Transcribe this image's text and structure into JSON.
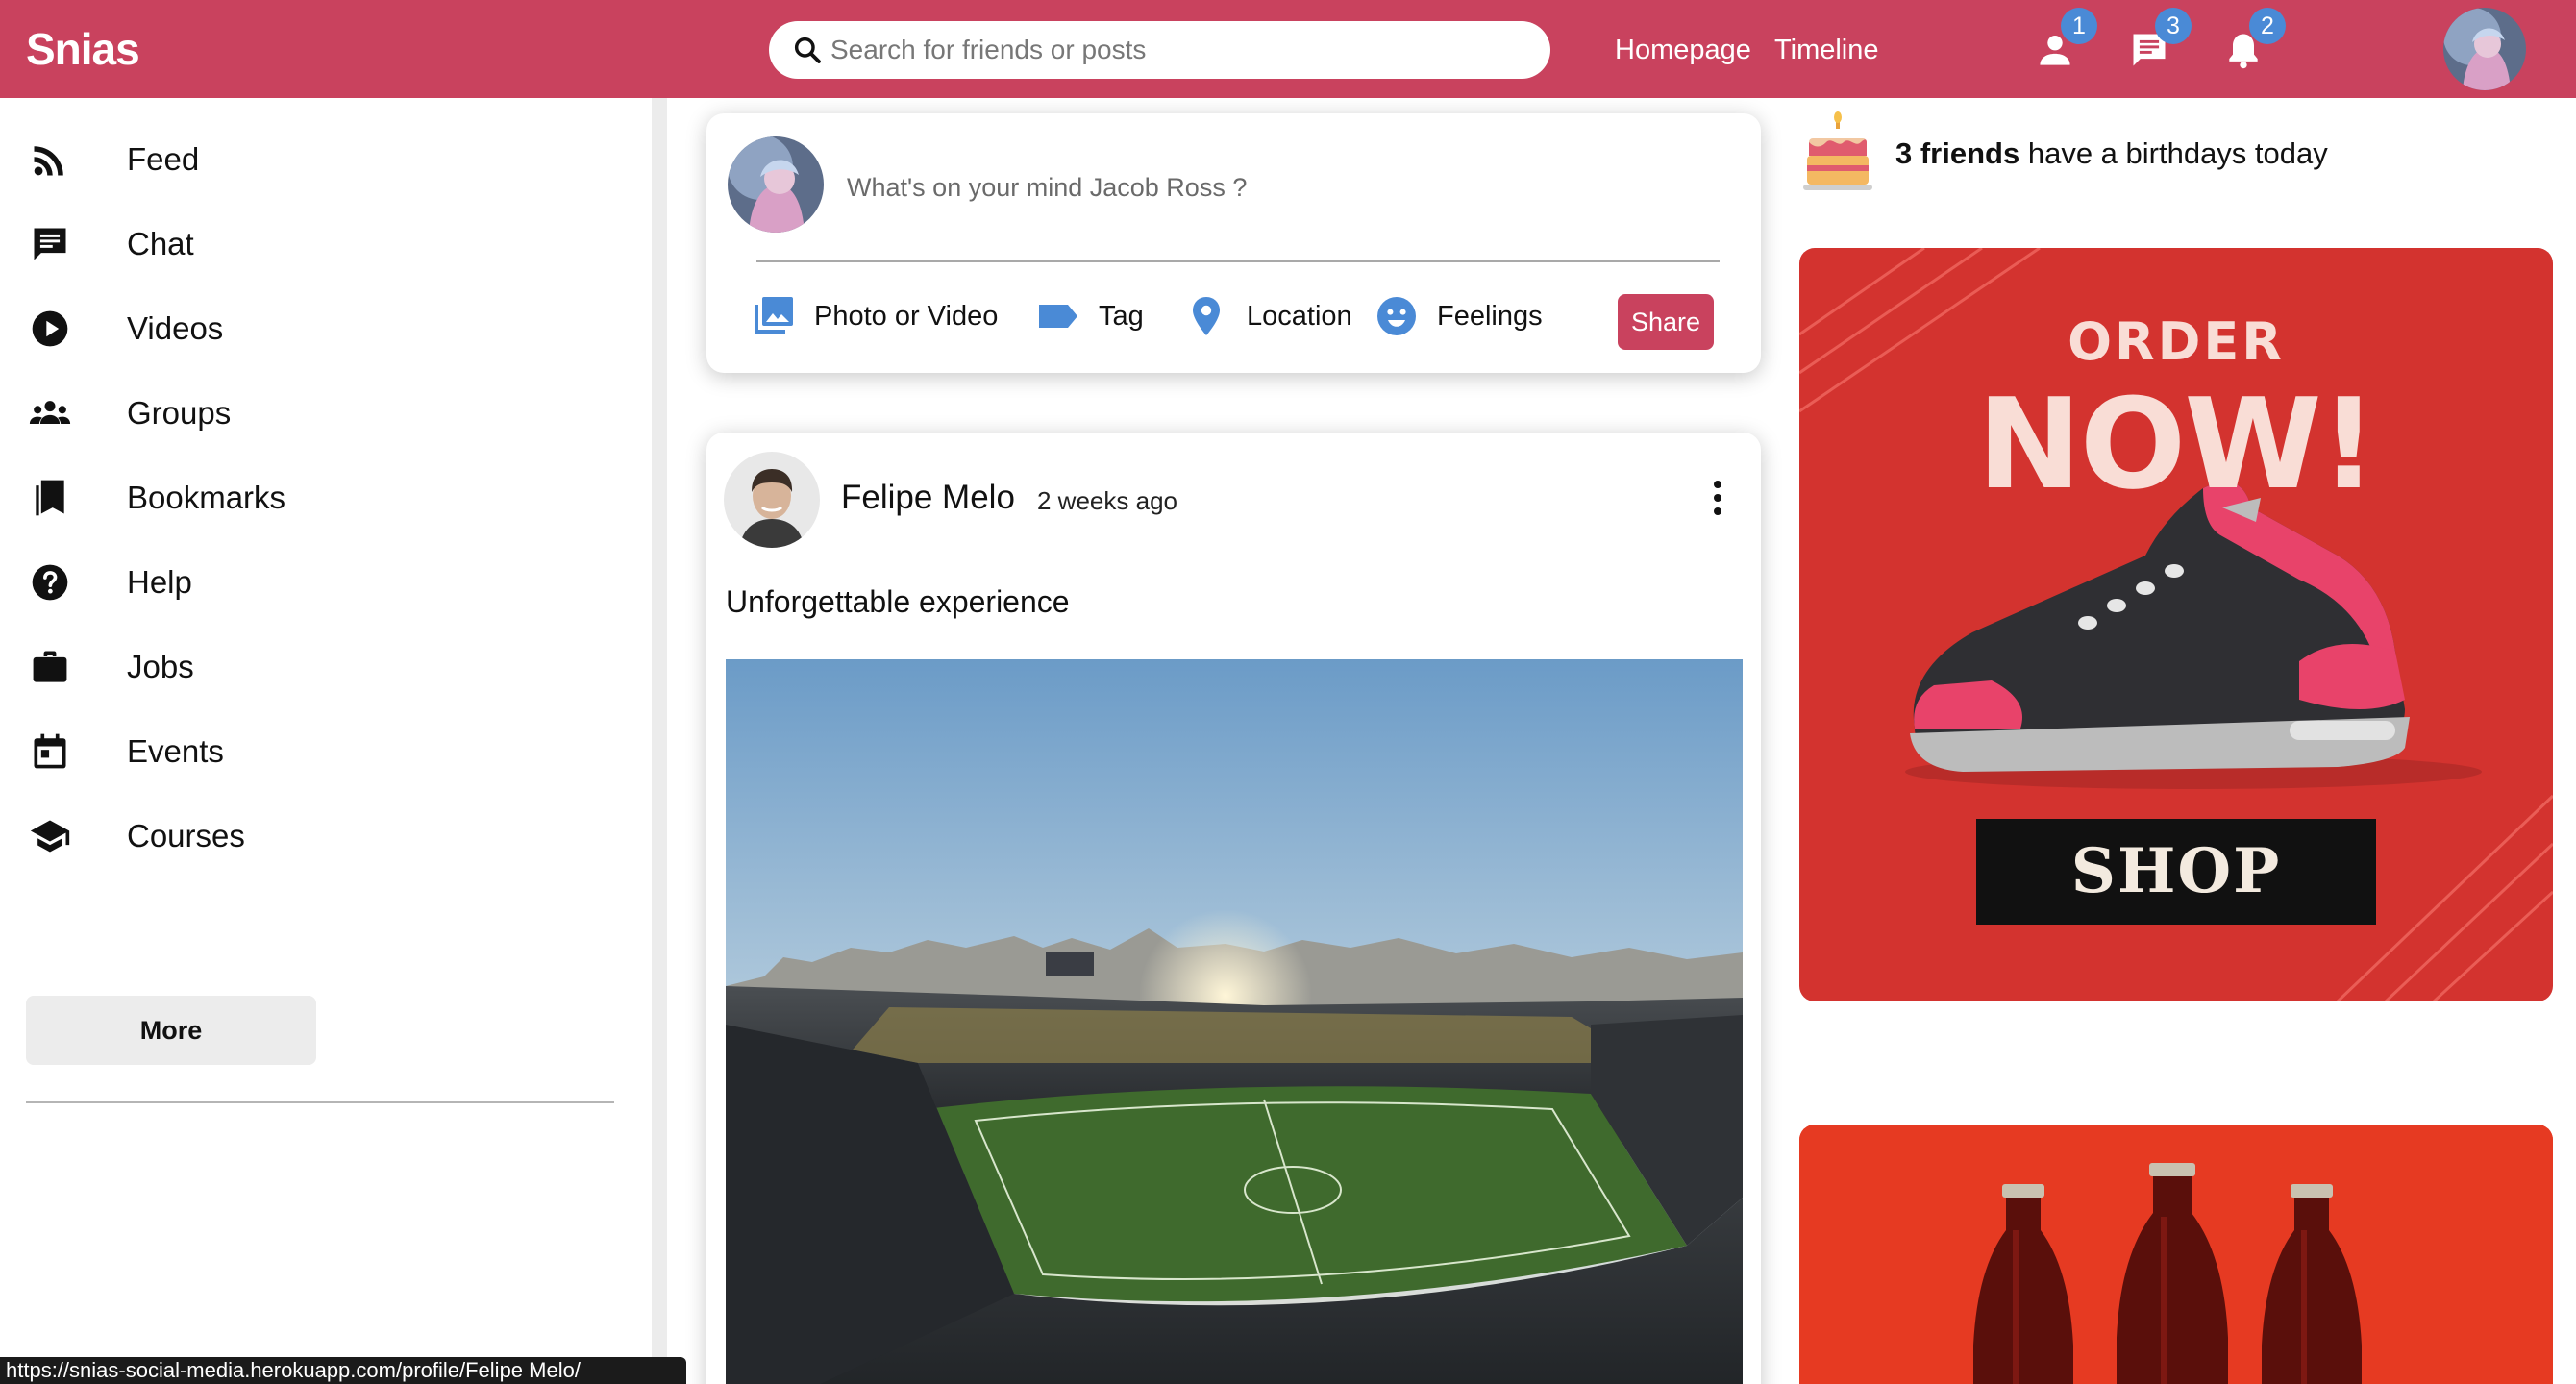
{
  "app": {
    "name": "Snias"
  },
  "search": {
    "placeholder": "Search for friends or posts"
  },
  "topnav": {
    "links": [
      "Homepage",
      "Timeline"
    ],
    "badges": {
      "friends": "1",
      "messages": "3",
      "notifications": "2"
    }
  },
  "sidebar": {
    "items": [
      {
        "label": "Feed",
        "icon": "rss-feed-icon"
      },
      {
        "label": "Chat",
        "icon": "chat-icon"
      },
      {
        "label": "Videos",
        "icon": "play-circle-icon"
      },
      {
        "label": "Groups",
        "icon": "groups-icon"
      },
      {
        "label": "Bookmarks",
        "icon": "bookmarks-icon"
      },
      {
        "label": "Help",
        "icon": "help-icon"
      },
      {
        "label": "Jobs",
        "icon": "briefcase-icon"
      },
      {
        "label": "Events",
        "icon": "calendar-icon"
      },
      {
        "label": "Courses",
        "icon": "graduation-cap-icon"
      }
    ],
    "more_label": "More"
  },
  "composer": {
    "placeholder": "What's on your mind Jacob Ross ?",
    "options": [
      "Photo or Video",
      "Tag",
      "Location",
      "Feelings"
    ],
    "share_label": "Share"
  },
  "post": {
    "author": "Felipe Melo",
    "time": "2 weeks ago",
    "text": "Unforgettable experience"
  },
  "rightbar": {
    "birthday_count": "3 friends",
    "birthday_text": " have a birthdays today",
    "ad1": {
      "line1": "ORDER",
      "line2": "NOW!",
      "button": "SHOP"
    }
  },
  "statusbar": {
    "url": "https://snias-social-media.herokuapp.com/profile/Felipe Melo/"
  },
  "colors": {
    "brand": "#c9425e",
    "badge": "#4a8ad6",
    "composer_icons": "#4a8ad6"
  }
}
